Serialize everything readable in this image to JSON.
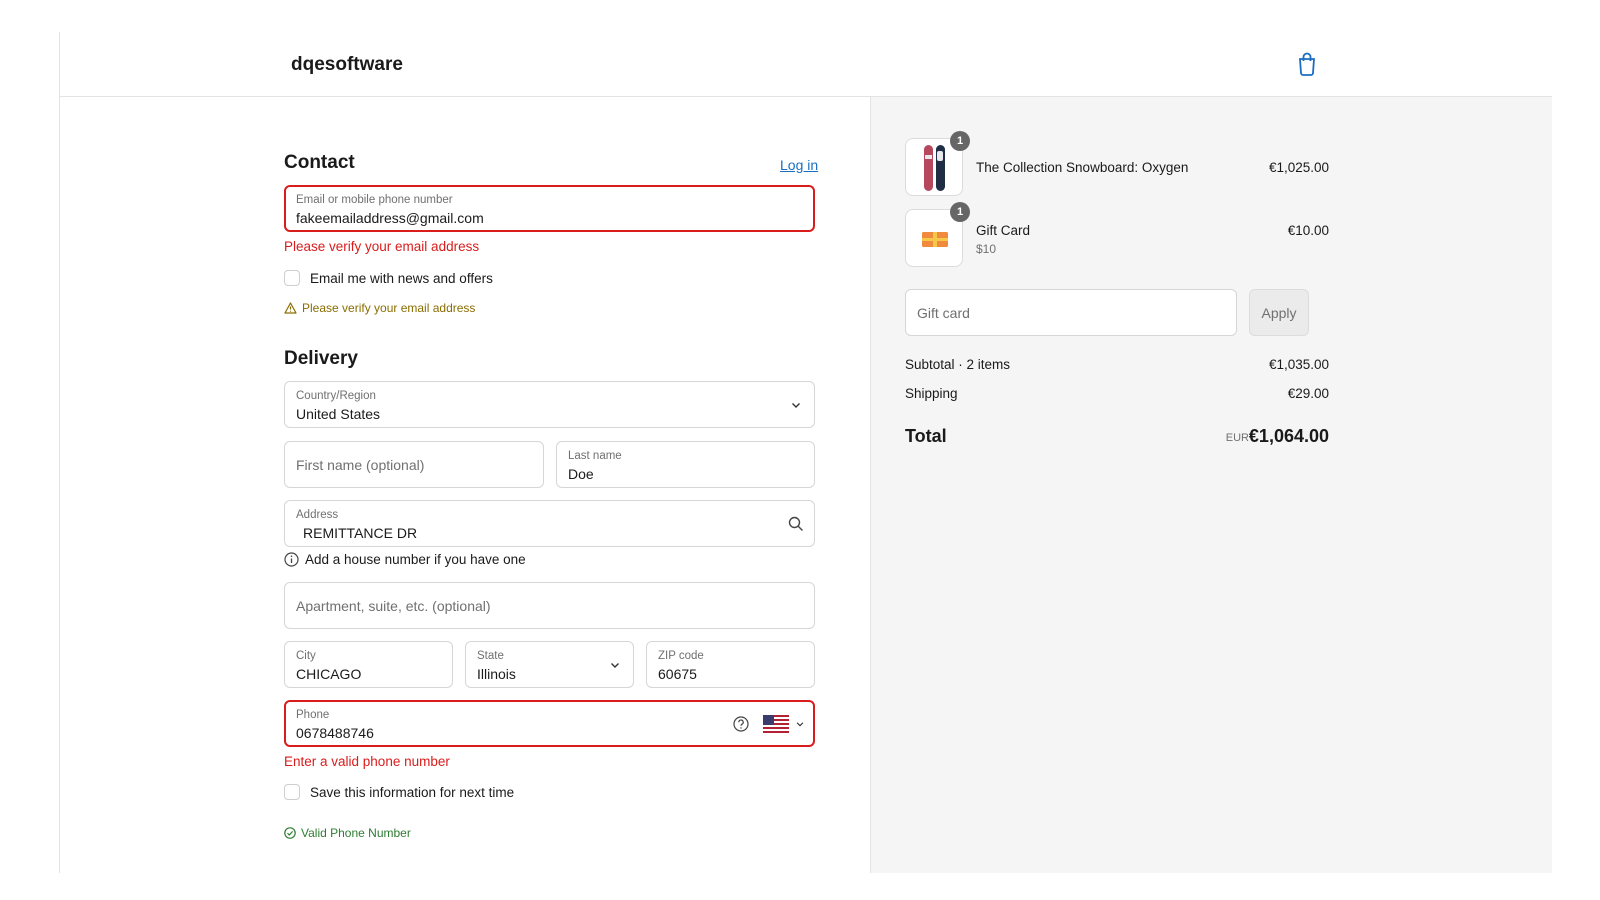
{
  "store": {
    "name": "dqesoftware",
    "cart_icon": "shopping-bag-icon"
  },
  "contact": {
    "heading": "Contact",
    "login_link": "Log in",
    "email_label": "Email or mobile phone number",
    "email_value": "fakeemailaddress@gmail.com",
    "email_error": "Please verify your email address",
    "news_checkbox_label": "Email me with news and offers",
    "news_checked": false,
    "warning": "Please verify your email address"
  },
  "delivery": {
    "heading": "Delivery",
    "country_label": "Country/Region",
    "country_value": "United States",
    "first_name_placeholder": "First name (optional)",
    "last_name_label": "Last name",
    "last_name_value": "Doe",
    "address_label": "Address",
    "address_value": "REMITTANCE DR",
    "address_hint": "Add a house number if you have one",
    "apartment_placeholder": "Apartment, suite, etc. (optional)",
    "city_label": "City",
    "city_value": "CHICAGO",
    "state_label": "State",
    "state_value": "Illinois",
    "zip_label": "ZIP code",
    "zip_value": "60675",
    "phone_label": "Phone",
    "phone_value": "0678488746",
    "phone_error": "Enter a valid phone number",
    "save_checkbox_label": "Save this information for next time",
    "save_checked": false,
    "valid_phone_note": "Valid Phone Number"
  },
  "order": {
    "items": [
      {
        "name": "The Collection Snowboard: Oxygen",
        "variant": "",
        "quantity": "1",
        "price": "€1,025.00",
        "icon": "snowboard-thumbnail"
      },
      {
        "name": "Gift Card",
        "variant": "$10",
        "quantity": "1",
        "price": "€10.00",
        "icon": "gift-card-thumbnail"
      }
    ],
    "gift_card_placeholder": "Gift card",
    "apply_label": "Apply",
    "subtotal_label": "Subtotal · 2 items",
    "subtotal_value": "€1,035.00",
    "shipping_label": "Shipping",
    "shipping_value": "€29.00",
    "total_label": "Total",
    "total_currency": "EUR",
    "total_value": "€1,064.00"
  },
  "colors": {
    "error": "#d91c1c",
    "link": "#1b6ec2",
    "warning": "#8a6d00",
    "success": "#2e7d32",
    "sidebar_bg": "#f5f5f5"
  }
}
